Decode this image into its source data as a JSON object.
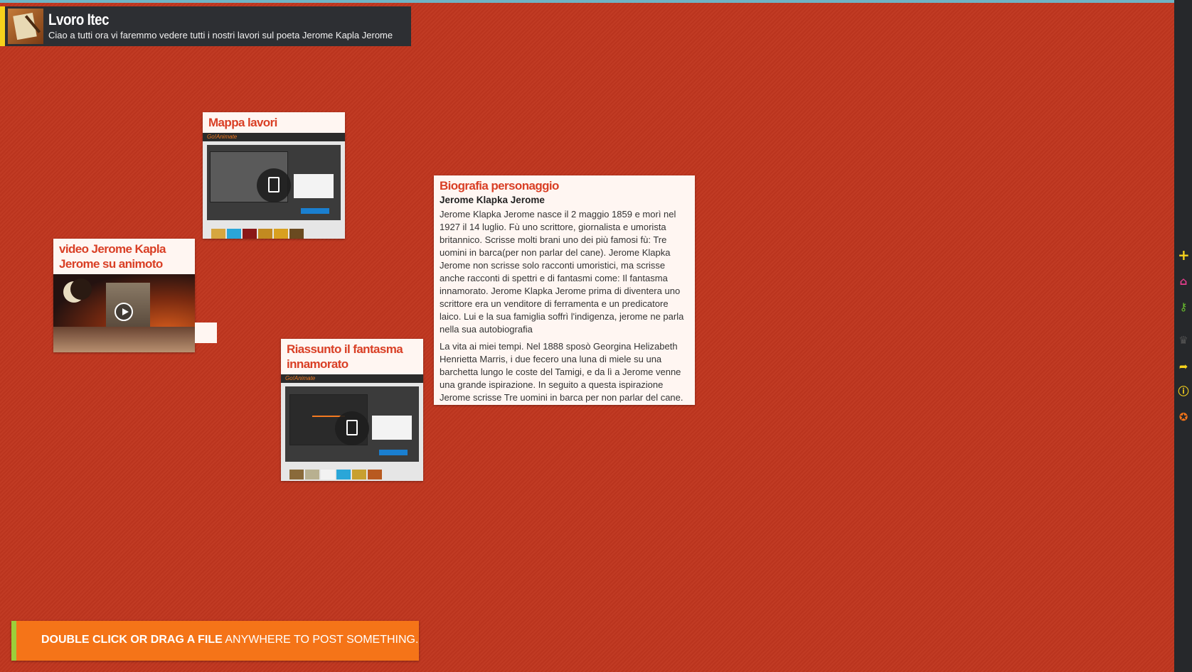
{
  "header": {
    "title": "Lvoro Itec",
    "subtitle": "Ciao a tutti ora vi faremmo vedere tutti i nostri lavori sul poeta Jerome Kapla Jerome"
  },
  "posts": {
    "mappa": {
      "title": "Mappa lavori",
      "thumb_logo": "Go!Animate"
    },
    "video": {
      "title": "video Jerome Kapla Jerome su animoto"
    },
    "riassunto": {
      "title": "Riassunto il fantasma innamorato",
      "thumb_logo": "Go!Animate"
    },
    "biografia": {
      "title": "Biografia personaggio",
      "subtitle": "Jerome Klapka Jerome",
      "paragraph1": "Jerome Klapka Jerome nasce il 2 maggio 1859 e morì nel 1927 il 14 luglio. Fù uno scrittore, giornalista e umorista britannico. Scrisse molti brani uno dei più famosi fù: Tre uomini in barca(per non parlar del cane). Jerome Klapka Jerome non scrisse solo racconti umoristici, ma scrisse anche racconti di spettri e di fantasmi come: Il fantasma innamorato. Jerome Klapka Jerome prima di diventera uno scrittore era un venditore di ferramenta e un predicatore laico. Lui e la sua famiglia soffrì l'indigenza, jerome ne parla nella sua autobiografia",
      "paragraph2": "La vita ai miei tempi. Nel 1888 sposò Georgina Helizabeth Henrietta Marris, i due fecero una luna di miele su una barchetta lungo le coste del Tamigi, e da lì a Jerome venne una grande ispirazione. In seguito a questa ispirazione Jerome scrisse Tre uomini in barca per non parlar del cane."
    }
  },
  "sidebar": {
    "icons": [
      "plus-icon",
      "home-icon",
      "key-icon",
      "crown-icon",
      "share-icon",
      "info-icon",
      "help-icon"
    ],
    "colors": {
      "plus": "#f6d21c",
      "home": "#e43d8c",
      "key": "#6abf2e",
      "crown": "#555555",
      "share": "#f6d21c",
      "info": "#f6d21c",
      "help": "#f57418"
    }
  },
  "footer": {
    "bold": "DOUBLE CLICK OR DRAG A FILE",
    "rest": " ANYWHERE TO POST SOMETHING."
  },
  "colors": {
    "background": "#c0361f",
    "post_title": "#d93f25",
    "footer": "#f57418"
  }
}
